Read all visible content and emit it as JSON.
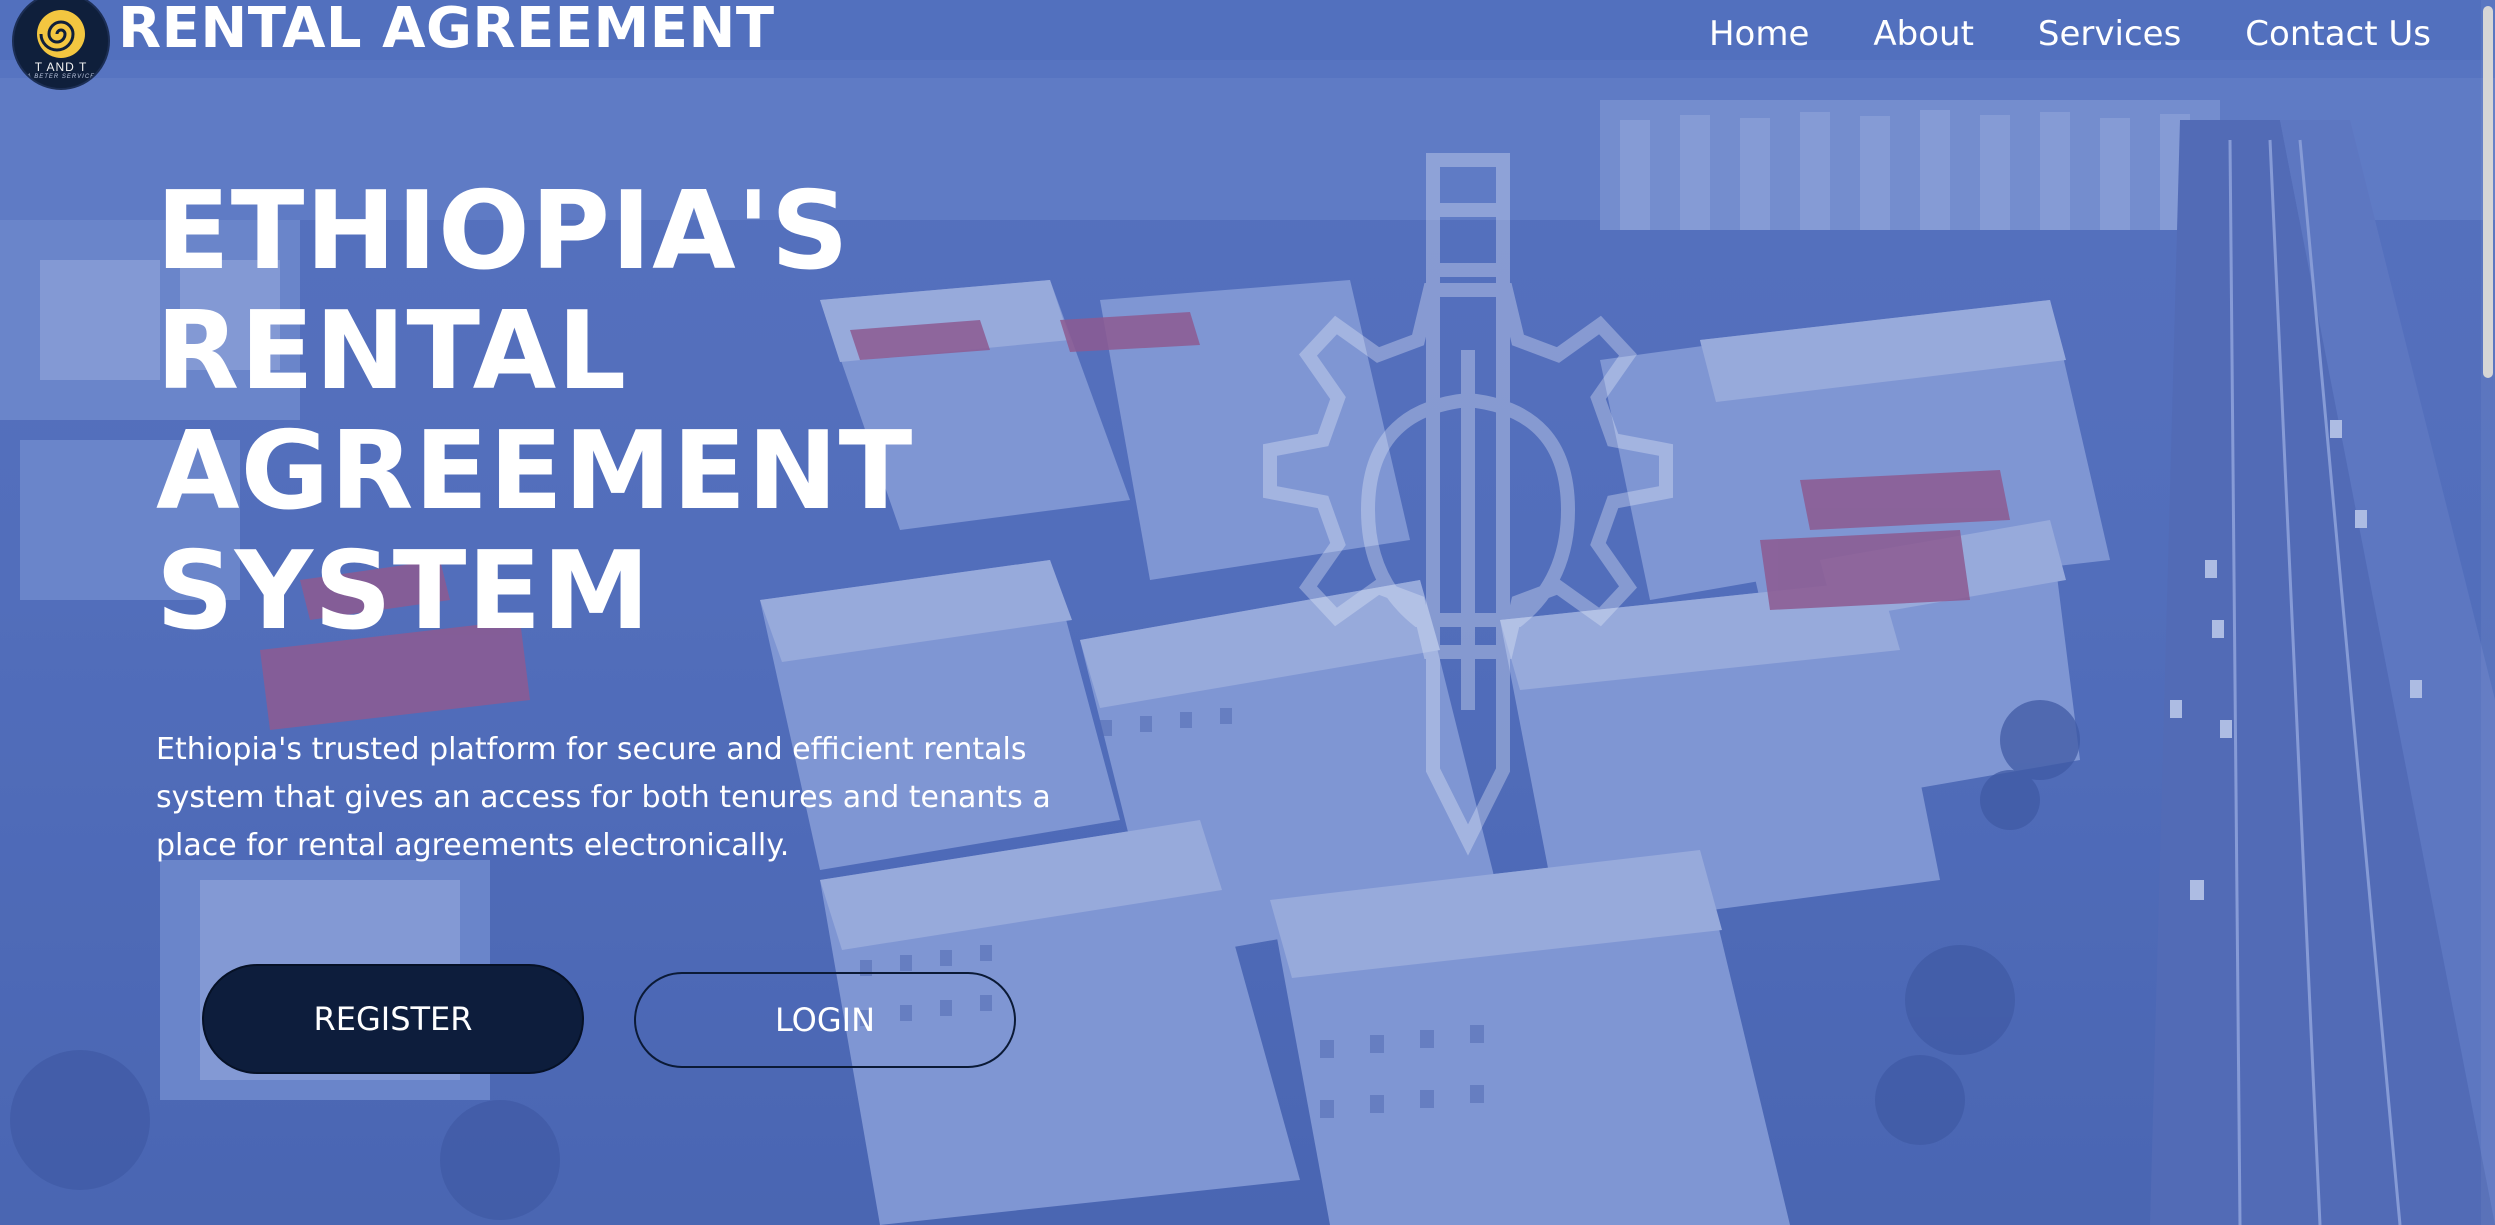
{
  "header": {
    "logo": {
      "text": "T AND T",
      "subtext": "A BETER SERVICE"
    },
    "brand": "RENTAL AGREEMENT",
    "nav": [
      {
        "label": "Home"
      },
      {
        "label": "About"
      },
      {
        "label": "Services"
      },
      {
        "label": "Contact Us"
      }
    ]
  },
  "hero": {
    "title_lines": [
      "ETHIOPIA'S",
      "RENTAL",
      "AGREEMENT",
      "SYSTEM"
    ],
    "description": "Ethiopia's trusted platform for secure and efficient rentals system that gives an access for both tenures and tenants a place for rental agreements electronically.",
    "register_label": "REGISTER",
    "login_label": "LOGIN"
  },
  "colors": {
    "overlay": "#5570c0",
    "button_dark": "#0d1d3c",
    "text": "#ffffff"
  },
  "icons": {
    "logo": "snail-logo-icon",
    "watermark": "gear-pen-watermark-icon"
  }
}
